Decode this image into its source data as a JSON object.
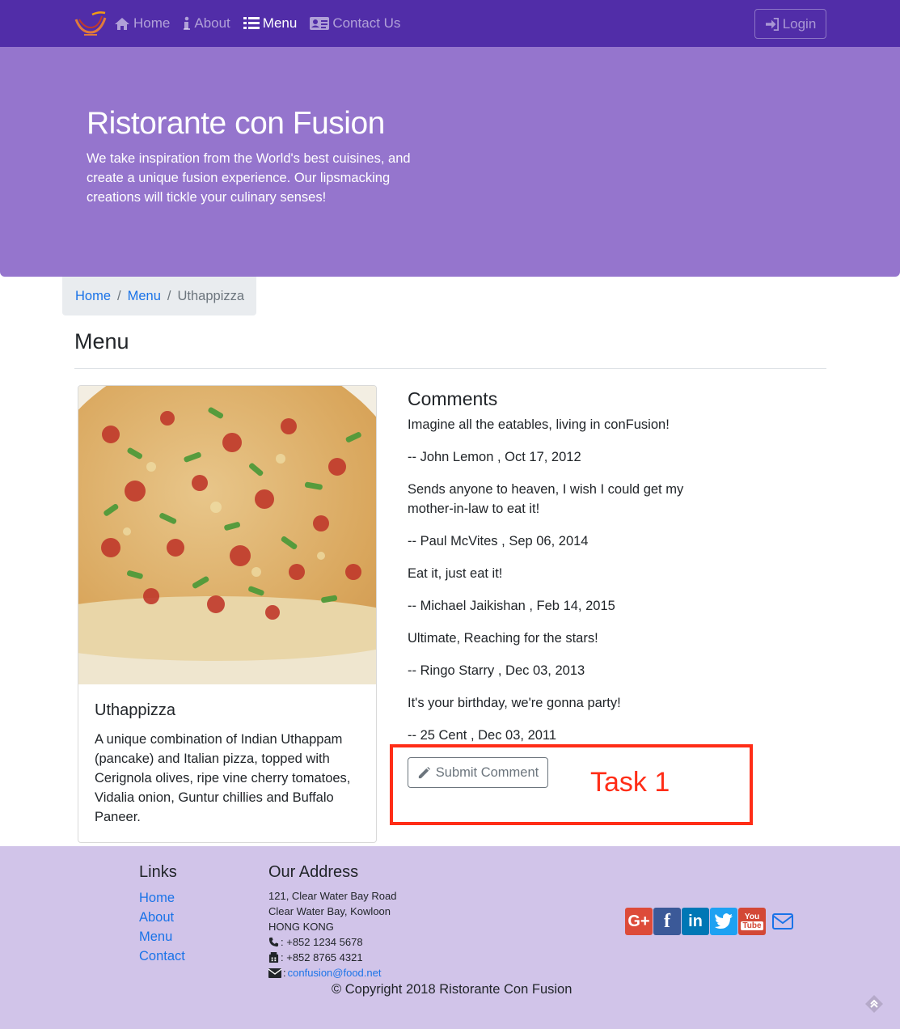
{
  "nav": {
    "items": [
      {
        "label": "Home",
        "icon": "home-icon"
      },
      {
        "label": "About",
        "icon": "info-icon"
      },
      {
        "label": "Menu",
        "icon": "list-icon",
        "active": true
      },
      {
        "label": "Contact Us",
        "icon": "address-card-icon"
      }
    ],
    "login_label": "Login"
  },
  "jumbotron": {
    "title": "Ristorante con Fusion",
    "text": "We take inspiration from the World's best cuisines, and create a unique fusion experience. Our lipsmacking creations will tickle your culinary senses!"
  },
  "breadcrumb": {
    "home": "Home",
    "menu": "Menu",
    "current": "Uthappizza",
    "separator": "/"
  },
  "page": {
    "heading": "Menu"
  },
  "dish": {
    "name": "Uthappizza",
    "description": "A unique combination of Indian Uthappam (pancake) and Italian pizza, topped with Cerignola olives, ripe vine cherry tomatoes, Vidalia onion, Guntur chillies and Buffalo Paneer."
  },
  "comments": {
    "title": "Comments",
    "items": [
      {
        "text": "Imagine all the eatables, living in conFusion!",
        "byline": "-- John Lemon , Oct 17, 2012"
      },
      {
        "text": "Sends anyone to heaven, I wish I could get my mother-in-law to eat it!",
        "byline": "-- Paul McVites , Sep 06, 2014"
      },
      {
        "text": "Eat it, just eat it!",
        "byline": "-- Michael Jaikishan , Feb 14, 2015"
      },
      {
        "text": "Ultimate, Reaching for the stars!",
        "byline": "-- Ringo Starry , Dec 03, 2013"
      },
      {
        "text": "It's your birthday, we're gonna party!",
        "byline": "-- 25 Cent , Dec 03, 2011"
      }
    ],
    "submit_label": "Submit Comment"
  },
  "annotation": {
    "label": "Task 1",
    "color": "#ff2d17"
  },
  "footer": {
    "links_title": "Links",
    "links": [
      "Home",
      "About",
      "Menu",
      "Contact"
    ],
    "address_title": "Our Address",
    "address_lines": [
      "121, Clear Water Bay Road",
      "Clear Water Bay, Kowloon",
      "HONG KONG"
    ],
    "phone": ": +852 1234 5678",
    "fax": ": +852 8765 4321",
    "email": "confusion@food.net",
    "social_icons": [
      "google-plus-icon",
      "facebook-icon",
      "linkedin-icon",
      "twitter-icon",
      "youtube-icon",
      "envelope-icon"
    ],
    "copyright": "© Copyright 2018 Ristorante Con Fusion"
  },
  "colors": {
    "navbar": "#512DA8",
    "jumbotron": "#9575CD",
    "footer": "#D1C4E9",
    "link": "#1a73e8"
  }
}
